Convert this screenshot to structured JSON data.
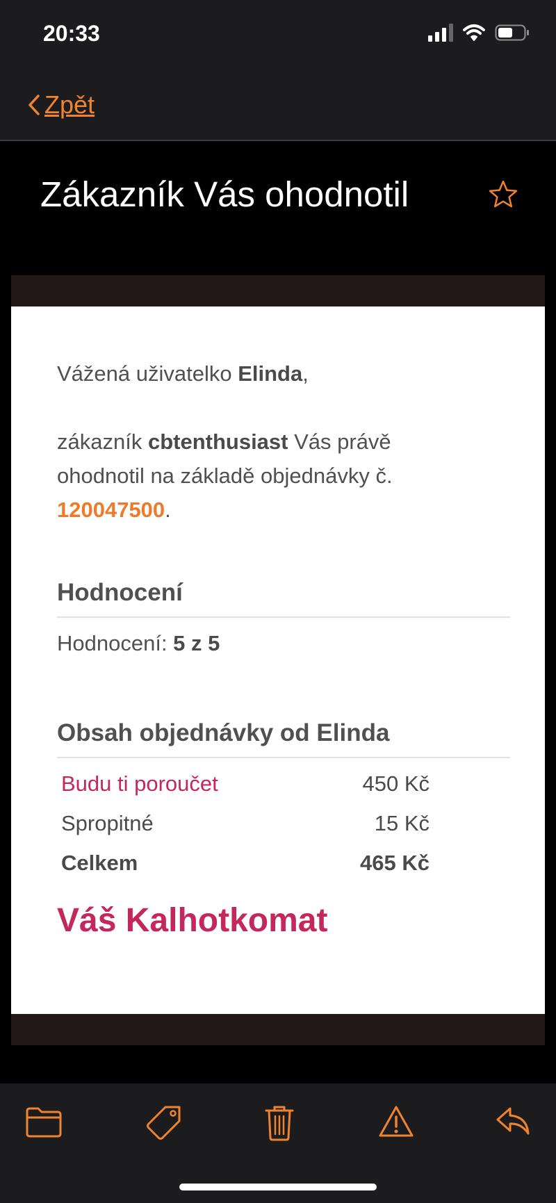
{
  "status": {
    "time": "20:33"
  },
  "nav": {
    "back_label": "Zpět"
  },
  "email": {
    "subject": "Zákazník Vás ohodnotil",
    "greeting_prefix": "Vážená uživatelko ",
    "user_name": "Elinda",
    "greeting_suffix": ",",
    "intro_prefix": "zákazník ",
    "customer_name": "cbtenthusiast",
    "intro_middle": " Vás právě ohodnotil na základě objednávky č. ",
    "order_number": "120047500",
    "intro_suffix": ".",
    "rating_heading": "Hodnocení",
    "rating_label": "Hodnocení: ",
    "rating_value": "5 z 5",
    "order_heading": "Obsah objednávky od Elinda",
    "items": [
      {
        "name": "Budu ti poroučet",
        "price": "450 Kč"
      },
      {
        "name": "Spropitné",
        "price": "15 Kč"
      },
      {
        "name": "Celkem",
        "price": "465 Kč"
      }
    ],
    "signature": "Váš Kalhotkomat"
  },
  "toolbar": {
    "icons": [
      "folder-icon",
      "tag-icon",
      "trash-icon",
      "warning-icon",
      "reply-icon"
    ]
  },
  "colors": {
    "accent": "#f0832f",
    "brand": "#c4285a",
    "order_link": "#ee7a2c"
  }
}
